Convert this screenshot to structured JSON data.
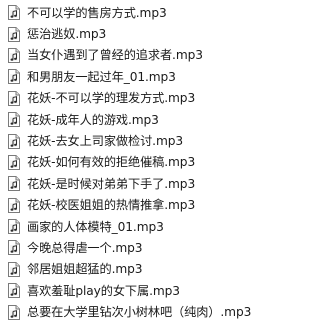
{
  "files": [
    {
      "name": "不可以学的售房方式.mp3",
      "icon": "audio-file-icon"
    },
    {
      "name": "惩治逃奴.mp3",
      "icon": "audio-file-icon"
    },
    {
      "name": "当女仆遇到了曾经的追求者.mp3",
      "icon": "audio-file-icon"
    },
    {
      "name": "和男朋友一起过年_01.mp3",
      "icon": "audio-file-icon"
    },
    {
      "name": "花妖-不可以学的理发方式.mp3",
      "icon": "audio-file-icon"
    },
    {
      "name": "花妖-成年人的游戏.mp3",
      "icon": "audio-file-icon"
    },
    {
      "name": "花妖-去女上司家做检讨.mp3",
      "icon": "audio-file-icon"
    },
    {
      "name": "花妖-如何有效的拒绝催稿.mp3",
      "icon": "audio-file-icon"
    },
    {
      "name": "花妖-是时候对弟弟下手了.mp3",
      "icon": "audio-file-icon"
    },
    {
      "name": "花妖-校医姐姐的热情推拿.mp3",
      "icon": "audio-file-icon"
    },
    {
      "name": "画家的人体模特_01.mp3",
      "icon": "audio-file-icon"
    },
    {
      "name": "今晚总得虐一个.mp3",
      "icon": "audio-file-icon"
    },
    {
      "name": "邻居姐姐超猛的.mp3",
      "icon": "audio-file-icon"
    },
    {
      "name": "喜欢羞耻play的女下属.mp3",
      "icon": "audio-file-icon"
    },
    {
      "name": "总要在大学里钻次小树林吧（纯肉）.mp3",
      "icon": "audio-file-icon"
    }
  ],
  "colors": {
    "icon_border": "#7a7a7a",
    "icon_fill": "#ffffff",
    "note_color": "#2b2b2b",
    "text": "#1a1a1a",
    "background": "#ffffff"
  }
}
